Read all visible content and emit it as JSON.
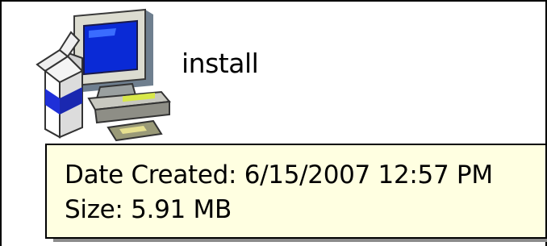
{
  "file": {
    "name": "install",
    "icon": "setup-installer-icon"
  },
  "tooltip": {
    "date_created": "Date Created: 6/15/2007 12:57 PM",
    "size": "Size: 5.91 MB",
    "background_color": "#ffffe1"
  }
}
